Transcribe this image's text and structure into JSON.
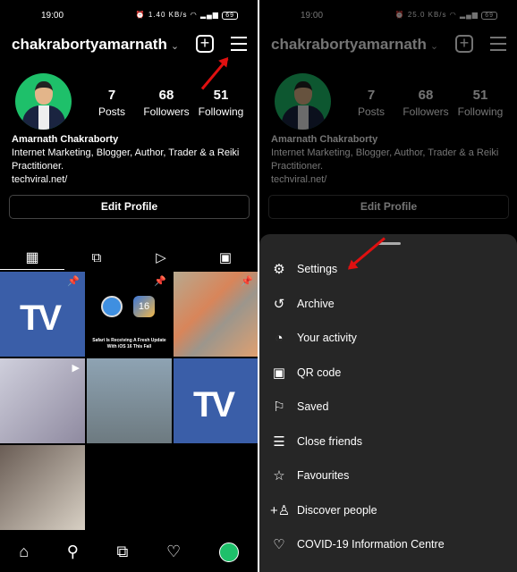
{
  "status": {
    "time": "19:00",
    "left_speed": "1.40 KB/s",
    "right_speed": "25.0 KB/s",
    "battery": "69"
  },
  "profile": {
    "username": "chakrabortyamarnath",
    "posts": "7",
    "posts_label": "Posts",
    "followers": "68",
    "followers_label": "Followers",
    "following": "51",
    "following_label": "Following",
    "name": "Amarnath Chakraborty",
    "bio": "Internet Marketing, Blogger, Author, Trader & a Reiki Practitioner.",
    "link": "techviral.net/",
    "edit_label": "Edit Profile"
  },
  "grid": {
    "tv_text": "TV",
    "safari_caption": "Safari Is Receiving A Fresh Update With iOS 16 This Fall",
    "ios_badge": "16"
  },
  "menu": {
    "items": [
      {
        "label": "Settings",
        "icon": "settings-icon"
      },
      {
        "label": "Archive",
        "icon": "archive-icon"
      },
      {
        "label": "Your activity",
        "icon": "activity-icon"
      },
      {
        "label": "QR code",
        "icon": "qr-code-icon"
      },
      {
        "label": "Saved",
        "icon": "bookmark-icon"
      },
      {
        "label": "Close friends",
        "icon": "close-friends-icon"
      },
      {
        "label": "Favourites",
        "icon": "star-icon"
      },
      {
        "label": "Discover people",
        "icon": "add-person-icon"
      },
      {
        "label": "COVID-19 Information Centre",
        "icon": "covid-icon"
      }
    ]
  },
  "colors": {
    "annotation_arrow": "#e01010",
    "accent_green": "#1ec06a",
    "tv_blue": "#3a5ea8",
    "sheet": "#262626"
  }
}
